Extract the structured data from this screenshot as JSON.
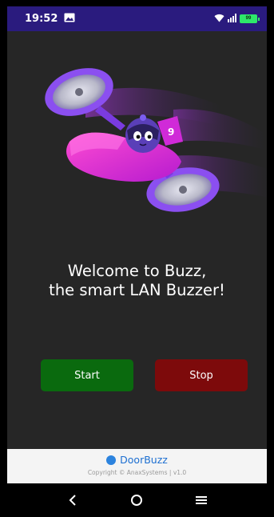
{
  "status_bar": {
    "time": "19:52",
    "battery_level": "99",
    "icons": [
      "image-notification-icon",
      "wifi-icon",
      "signal-icon",
      "battery-icon"
    ]
  },
  "main": {
    "welcome_line1": "Welcome to Buzz,",
    "welcome_line2": "the smart LAN Buzzer!",
    "start_label": "Start",
    "stop_label": "Stop",
    "hero_badge": "9"
  },
  "footer": {
    "brand": "DoorBuzz",
    "copyright": "Copyright © AnaxSystems | v1.0"
  },
  "colors": {
    "status_bar": "#2a1b7e",
    "background": "#262626",
    "start_button": "#0a6a0e",
    "stop_button": "#7d0a0b",
    "brand": "#1d6fd1",
    "footer_bg": "#f4f4f4"
  },
  "nav": [
    "back-icon",
    "home-icon",
    "recents-icon"
  ]
}
